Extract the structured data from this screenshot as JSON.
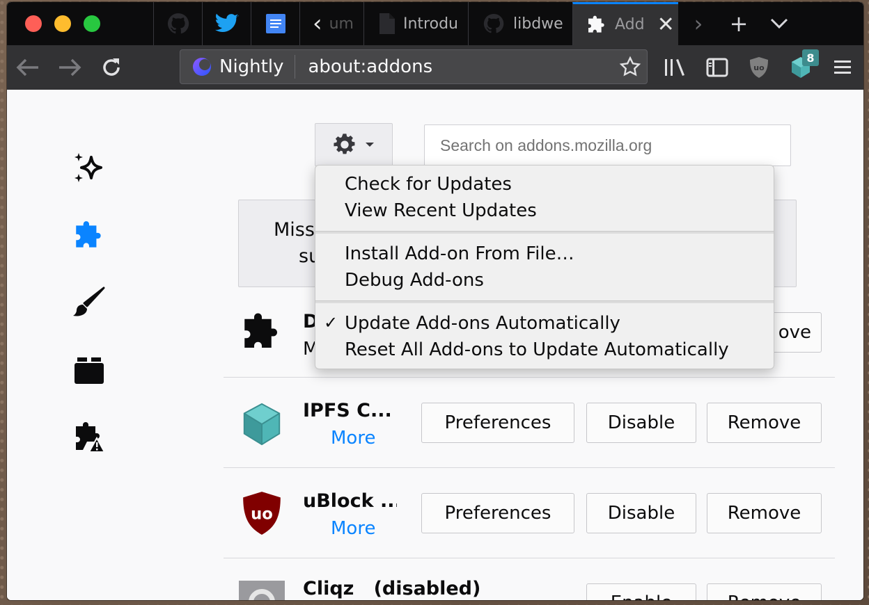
{
  "tabs": {
    "items": [
      {
        "label": "",
        "icon": "github-icon"
      },
      {
        "label": "",
        "icon": "twitter-icon"
      },
      {
        "label": "",
        "icon": "docs-icon"
      },
      {
        "label": "‹ um",
        "icon": "back-tab-icon"
      },
      {
        "label": "Introdu",
        "icon": "document-icon"
      },
      {
        "label": "libdwe",
        "icon": "github-icon"
      },
      {
        "label": "Add",
        "icon": "puzzle-icon"
      }
    ],
    "active_label": "Add",
    "close_symbol": "✕",
    "scroll_right": "›",
    "new_tab": "+",
    "all_tabs": "⌄"
  },
  "navbar": {
    "identity_label": "Nightly",
    "url": "about:addons",
    "extension_badge": "8"
  },
  "toolbar": {
    "search_placeholder": "Search on addons.mozilla.org"
  },
  "menu": {
    "items": [
      "Check for Updates",
      "View Recent Updates",
      "Install Add-on From File…",
      "Debug Add-ons",
      "Update Add-ons Automatically",
      "Reset All Add-ons to Update Automatically"
    ],
    "checkmark": "✓"
  },
  "notice": {
    "line1": "Miss",
    "line2": "su"
  },
  "addons": [
    {
      "name": "D",
      "more": "M",
      "remove_partial": "ove"
    },
    {
      "name": "IPFS C...",
      "more": "More",
      "preferences": "Preferences",
      "disable": "Disable",
      "remove": "Remove"
    },
    {
      "name": "uBlock ...",
      "more": "More",
      "preferences": "Preferences",
      "disable": "Disable",
      "remove": "Remove"
    },
    {
      "name": "Cliqz",
      "status": "(disabled)",
      "enable": "Enable",
      "remove": "Remove"
    }
  ]
}
